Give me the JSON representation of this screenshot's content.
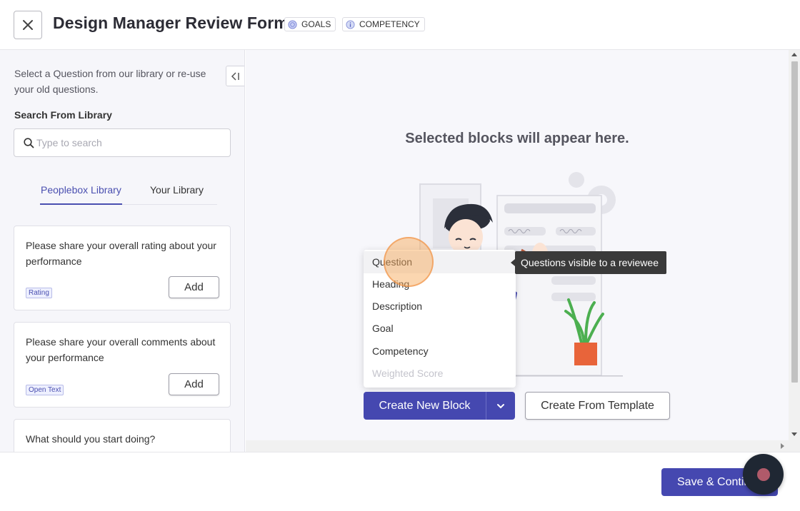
{
  "header": {
    "title": "Design Manager Review Form",
    "tags": [
      {
        "label": "GOALS",
        "icon": "target-icon"
      },
      {
        "label": "COMPETENCY",
        "icon": "info-circle-icon"
      }
    ]
  },
  "sidebar": {
    "intro": "Select a Question from our library or re-use your old questions.",
    "search_label": "Search From Library",
    "search_placeholder": "Type to search",
    "tabs": [
      {
        "label": "Peoplebox Library",
        "active": true
      },
      {
        "label": "Your Library",
        "active": false
      }
    ],
    "questions": [
      {
        "text": "Please share your overall rating about your performance",
        "badge": "Rating",
        "add_label": "Add"
      },
      {
        "text": "Please share your overall comments about your performance",
        "badge": "Open Text",
        "add_label": "Add"
      },
      {
        "text": "What should you start doing?"
      }
    ]
  },
  "main": {
    "placeholder_title": "Selected blocks will appear here.",
    "dropdown_items": [
      "Question",
      "Heading",
      "Description",
      "Goal",
      "Competency",
      "Weighted Score"
    ],
    "tooltip": "Questions visible to a reviewee",
    "create_block_label": "Create New Block",
    "create_template_label": "Create From Template"
  },
  "footer": {
    "save_label": "Save & Continue"
  },
  "colors": {
    "primary": "#4548b0",
    "accent_tab": "#4a4fb0",
    "highlight": "#f7aa5a",
    "plant_pot": "#e8643a",
    "plant_leaf": "#4caf50"
  }
}
